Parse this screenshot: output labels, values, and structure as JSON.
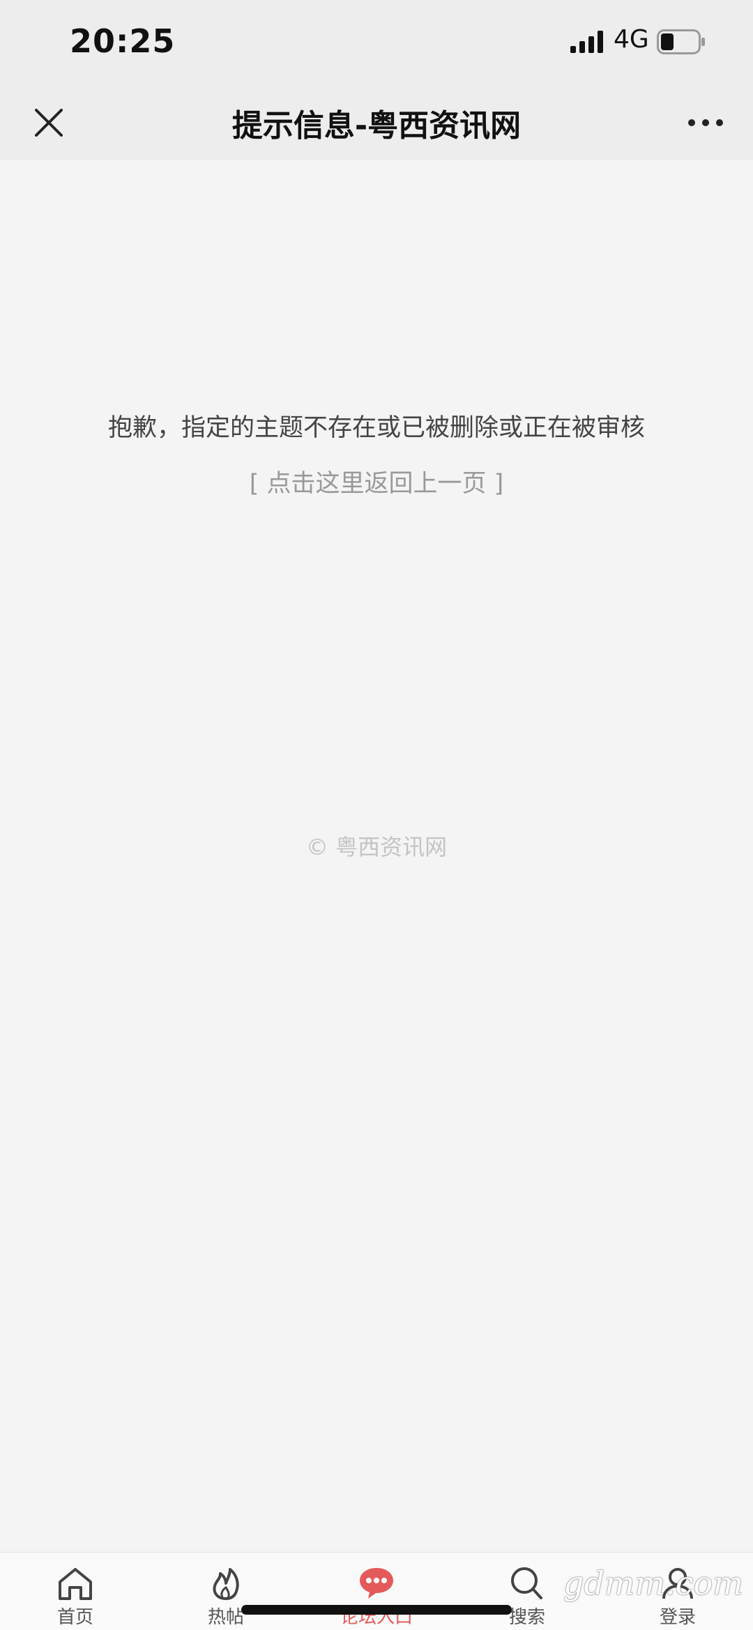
{
  "status_bar": {
    "time": "20:25",
    "network": "4G",
    "icons": [
      "signal-icon",
      "battery-icon"
    ]
  },
  "header": {
    "title": "提示信息-粤西资讯网",
    "icons": [
      "close-icon",
      "more-icon"
    ]
  },
  "main": {
    "message": "抱歉，指定的主题不存在或已被删除或正在被审核",
    "back_link": "[ 点击这里返回上一页 ]",
    "copyright": "© 粤西资讯网"
  },
  "tab_bar": {
    "items": [
      {
        "label": "首页",
        "icon": "home-icon",
        "active": false
      },
      {
        "label": "热帖",
        "icon": "flame-icon",
        "active": false
      },
      {
        "label": "论坛入口",
        "icon": "chat-bubble-icon",
        "active": true
      },
      {
        "label": "搜索",
        "icon": "search-icon",
        "active": false
      },
      {
        "label": "登录",
        "icon": "user-icon",
        "active": false
      }
    ],
    "active_color": "#e45a5a"
  },
  "watermark": "gdmm.com",
  "colors": {
    "header_bg": "#ededed",
    "page_bg": "#f4f4f4",
    "accent": "#e45a5a"
  }
}
